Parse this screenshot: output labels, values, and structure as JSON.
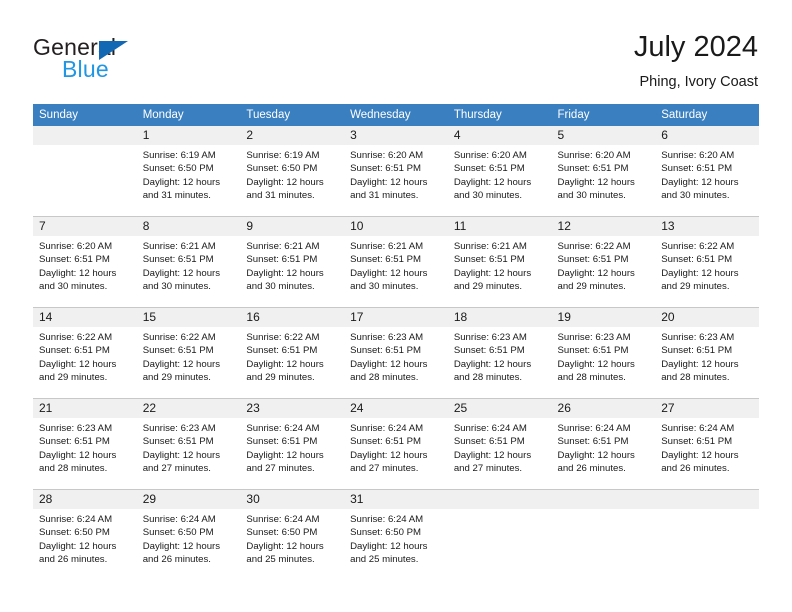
{
  "brand": {
    "name_top": "General",
    "name_bottom": "Blue",
    "triangle_color": "#1268b3",
    "blue_text_color": "#2196e3"
  },
  "header": {
    "title": "July 2024",
    "subtitle": "Phing, Ivory Coast"
  },
  "theme": {
    "header_row_bg": "#3a7fc0",
    "daynum_bg": "#f0f0f0",
    "grid_line": "#c8c8c8",
    "text": "#1a1a1a"
  },
  "weekday_headers": [
    "Sunday",
    "Monday",
    "Tuesday",
    "Wednesday",
    "Thursday",
    "Friday",
    "Saturday"
  ],
  "weeks": [
    [
      {
        "day": "",
        "empty": true,
        "sunrise": "",
        "sunset": "",
        "daylight_line1": "",
        "daylight_line2": ""
      },
      {
        "day": "1",
        "sunrise": "Sunrise: 6:19 AM",
        "sunset": "Sunset: 6:50 PM",
        "daylight_line1": "Daylight: 12 hours",
        "daylight_line2": "and 31 minutes."
      },
      {
        "day": "2",
        "sunrise": "Sunrise: 6:19 AM",
        "sunset": "Sunset: 6:50 PM",
        "daylight_line1": "Daylight: 12 hours",
        "daylight_line2": "and 31 minutes."
      },
      {
        "day": "3",
        "sunrise": "Sunrise: 6:20 AM",
        "sunset": "Sunset: 6:51 PM",
        "daylight_line1": "Daylight: 12 hours",
        "daylight_line2": "and 31 minutes."
      },
      {
        "day": "4",
        "sunrise": "Sunrise: 6:20 AM",
        "sunset": "Sunset: 6:51 PM",
        "daylight_line1": "Daylight: 12 hours",
        "daylight_line2": "and 30 minutes."
      },
      {
        "day": "5",
        "sunrise": "Sunrise: 6:20 AM",
        "sunset": "Sunset: 6:51 PM",
        "daylight_line1": "Daylight: 12 hours",
        "daylight_line2": "and 30 minutes."
      },
      {
        "day": "6",
        "sunrise": "Sunrise: 6:20 AM",
        "sunset": "Sunset: 6:51 PM",
        "daylight_line1": "Daylight: 12 hours",
        "daylight_line2": "and 30 minutes."
      }
    ],
    [
      {
        "day": "7",
        "sunrise": "Sunrise: 6:20 AM",
        "sunset": "Sunset: 6:51 PM",
        "daylight_line1": "Daylight: 12 hours",
        "daylight_line2": "and 30 minutes."
      },
      {
        "day": "8",
        "sunrise": "Sunrise: 6:21 AM",
        "sunset": "Sunset: 6:51 PM",
        "daylight_line1": "Daylight: 12 hours",
        "daylight_line2": "and 30 minutes."
      },
      {
        "day": "9",
        "sunrise": "Sunrise: 6:21 AM",
        "sunset": "Sunset: 6:51 PM",
        "daylight_line1": "Daylight: 12 hours",
        "daylight_line2": "and 30 minutes."
      },
      {
        "day": "10",
        "sunrise": "Sunrise: 6:21 AM",
        "sunset": "Sunset: 6:51 PM",
        "daylight_line1": "Daylight: 12 hours",
        "daylight_line2": "and 30 minutes."
      },
      {
        "day": "11",
        "sunrise": "Sunrise: 6:21 AM",
        "sunset": "Sunset: 6:51 PM",
        "daylight_line1": "Daylight: 12 hours",
        "daylight_line2": "and 29 minutes."
      },
      {
        "day": "12",
        "sunrise": "Sunrise: 6:22 AM",
        "sunset": "Sunset: 6:51 PM",
        "daylight_line1": "Daylight: 12 hours",
        "daylight_line2": "and 29 minutes."
      },
      {
        "day": "13",
        "sunrise": "Sunrise: 6:22 AM",
        "sunset": "Sunset: 6:51 PM",
        "daylight_line1": "Daylight: 12 hours",
        "daylight_line2": "and 29 minutes."
      }
    ],
    [
      {
        "day": "14",
        "sunrise": "Sunrise: 6:22 AM",
        "sunset": "Sunset: 6:51 PM",
        "daylight_line1": "Daylight: 12 hours",
        "daylight_line2": "and 29 minutes."
      },
      {
        "day": "15",
        "sunrise": "Sunrise: 6:22 AM",
        "sunset": "Sunset: 6:51 PM",
        "daylight_line1": "Daylight: 12 hours",
        "daylight_line2": "and 29 minutes."
      },
      {
        "day": "16",
        "sunrise": "Sunrise: 6:22 AM",
        "sunset": "Sunset: 6:51 PM",
        "daylight_line1": "Daylight: 12 hours",
        "daylight_line2": "and 29 minutes."
      },
      {
        "day": "17",
        "sunrise": "Sunrise: 6:23 AM",
        "sunset": "Sunset: 6:51 PM",
        "daylight_line1": "Daylight: 12 hours",
        "daylight_line2": "and 28 minutes."
      },
      {
        "day": "18",
        "sunrise": "Sunrise: 6:23 AM",
        "sunset": "Sunset: 6:51 PM",
        "daylight_line1": "Daylight: 12 hours",
        "daylight_line2": "and 28 minutes."
      },
      {
        "day": "19",
        "sunrise": "Sunrise: 6:23 AM",
        "sunset": "Sunset: 6:51 PM",
        "daylight_line1": "Daylight: 12 hours",
        "daylight_line2": "and 28 minutes."
      },
      {
        "day": "20",
        "sunrise": "Sunrise: 6:23 AM",
        "sunset": "Sunset: 6:51 PM",
        "daylight_line1": "Daylight: 12 hours",
        "daylight_line2": "and 28 minutes."
      }
    ],
    [
      {
        "day": "21",
        "sunrise": "Sunrise: 6:23 AM",
        "sunset": "Sunset: 6:51 PM",
        "daylight_line1": "Daylight: 12 hours",
        "daylight_line2": "and 28 minutes."
      },
      {
        "day": "22",
        "sunrise": "Sunrise: 6:23 AM",
        "sunset": "Sunset: 6:51 PM",
        "daylight_line1": "Daylight: 12 hours",
        "daylight_line2": "and 27 minutes."
      },
      {
        "day": "23",
        "sunrise": "Sunrise: 6:24 AM",
        "sunset": "Sunset: 6:51 PM",
        "daylight_line1": "Daylight: 12 hours",
        "daylight_line2": "and 27 minutes."
      },
      {
        "day": "24",
        "sunrise": "Sunrise: 6:24 AM",
        "sunset": "Sunset: 6:51 PM",
        "daylight_line1": "Daylight: 12 hours",
        "daylight_line2": "and 27 minutes."
      },
      {
        "day": "25",
        "sunrise": "Sunrise: 6:24 AM",
        "sunset": "Sunset: 6:51 PM",
        "daylight_line1": "Daylight: 12 hours",
        "daylight_line2": "and 27 minutes."
      },
      {
        "day": "26",
        "sunrise": "Sunrise: 6:24 AM",
        "sunset": "Sunset: 6:51 PM",
        "daylight_line1": "Daylight: 12 hours",
        "daylight_line2": "and 26 minutes."
      },
      {
        "day": "27",
        "sunrise": "Sunrise: 6:24 AM",
        "sunset": "Sunset: 6:51 PM",
        "daylight_line1": "Daylight: 12 hours",
        "daylight_line2": "and 26 minutes."
      }
    ],
    [
      {
        "day": "28",
        "sunrise": "Sunrise: 6:24 AM",
        "sunset": "Sunset: 6:50 PM",
        "daylight_line1": "Daylight: 12 hours",
        "daylight_line2": "and 26 minutes."
      },
      {
        "day": "29",
        "sunrise": "Sunrise: 6:24 AM",
        "sunset": "Sunset: 6:50 PM",
        "daylight_line1": "Daylight: 12 hours",
        "daylight_line2": "and 26 minutes."
      },
      {
        "day": "30",
        "sunrise": "Sunrise: 6:24 AM",
        "sunset": "Sunset: 6:50 PM",
        "daylight_line1": "Daylight: 12 hours",
        "daylight_line2": "and 25 minutes."
      },
      {
        "day": "31",
        "sunrise": "Sunrise: 6:24 AM",
        "sunset": "Sunset: 6:50 PM",
        "daylight_line1": "Daylight: 12 hours",
        "daylight_line2": "and 25 minutes."
      },
      {
        "day": "",
        "empty": true,
        "sunrise": "",
        "sunset": "",
        "daylight_line1": "",
        "daylight_line2": ""
      },
      {
        "day": "",
        "empty": true,
        "sunrise": "",
        "sunset": "",
        "daylight_line1": "",
        "daylight_line2": ""
      },
      {
        "day": "",
        "empty": true,
        "sunrise": "",
        "sunset": "",
        "daylight_line1": "",
        "daylight_line2": ""
      }
    ]
  ]
}
